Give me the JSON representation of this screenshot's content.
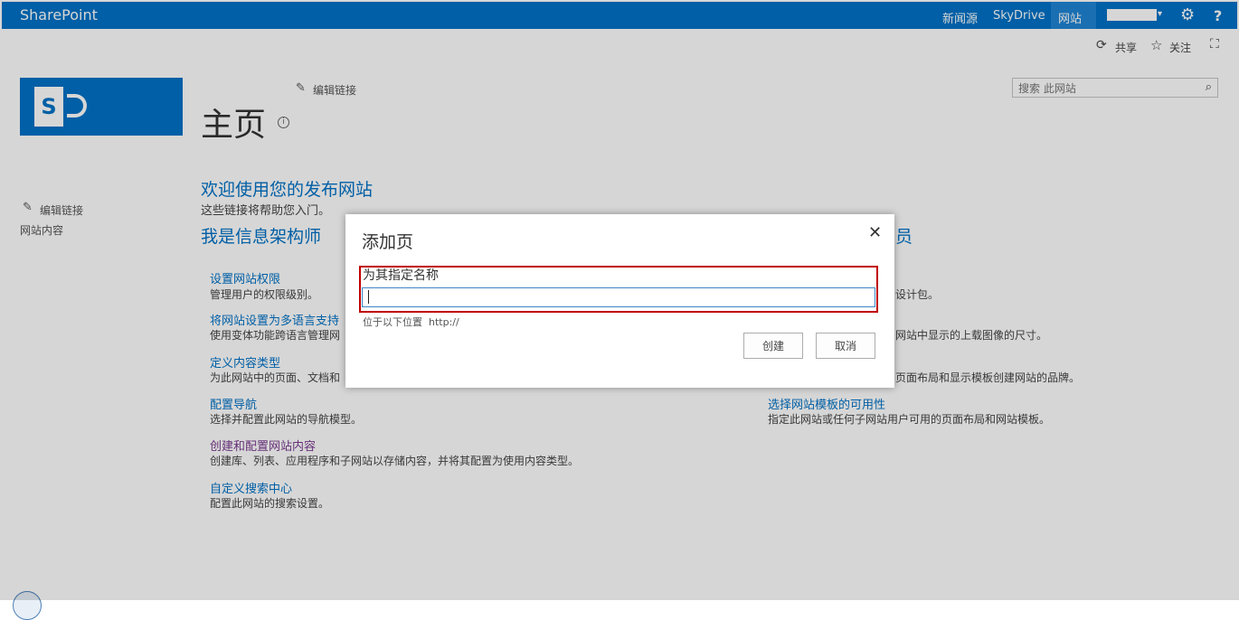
{
  "suite_bar": {
    "brand": "SharePoint",
    "links": [
      "新闻源",
      "SkyDrive",
      "网站"
    ],
    "active_link": "网站",
    "user_chevron": "▾",
    "gear_glyph": "⚙",
    "help_glyph": "?"
  },
  "ribbon": {
    "share_label": "共享",
    "follow_label": "关注",
    "share_glyph": "⟳",
    "follow_glyph": "☆",
    "focus_glyph": "⛶"
  },
  "site": {
    "logo_letter": "S",
    "edit_links_label": "编辑链接",
    "pencil_glyph": "✎",
    "page_title": "主页",
    "info_glyph": "i",
    "search_placeholder": "搜索 此网站",
    "search_glyph": "⌕"
  },
  "quick_launch": {
    "edit_links_label": "编辑链接",
    "site_contents_label": "网站内容"
  },
  "main": {
    "welcome_heading": "欢迎使用您的发布网站",
    "welcome_sub": "这些链接将帮助您入门。",
    "ia_heading": "我是信息架构师",
    "right_heading_fragment": "员",
    "left_items": [
      {
        "title": "设置网站权限",
        "desc": "管理用户的权限级别。"
      },
      {
        "title": "将网站设置为多语言支持",
        "desc": "使用变体功能跨语言管理网"
      },
      {
        "title": "定义内容类型",
        "desc": "为此网站中的页面、文档和"
      },
      {
        "title": "配置导航",
        "desc": "选择并配置此网站的导航模型。"
      },
      {
        "title": "创建和配置网站内容",
        "desc": "创建库、列表、应用程序和子网站以存储内容，并将其配置为使用内容类型。"
      },
      {
        "title": "自定义搜索中心",
        "desc": "配置此网站的搜索设置。"
      }
    ],
    "right_items": [
      {
        "title": "",
        "desc": "设计包。"
      },
      {
        "title": "",
        "desc": "网站中显示的上载图像的尺寸。"
      },
      {
        "title": "",
        "desc": "页面布局和显示模板创建网站的品牌。"
      },
      {
        "title": "选择网站模板的可用性",
        "desc": "指定此网站或任何子网站用户可用的页面布局和网站模板。"
      }
    ]
  },
  "dialog": {
    "title": "添加页",
    "close_glyph": "✕",
    "name_label": "为其指定名称",
    "name_value": "",
    "location_label": "位于以下位置",
    "location_url": "http://",
    "create_label": "创建",
    "cancel_label": "取消"
  },
  "colors": {
    "suite_blue": "#0072c6",
    "link_blue": "#0072c6",
    "visited_purple": "#7a3a8f",
    "highlight_red": "#c00000"
  }
}
